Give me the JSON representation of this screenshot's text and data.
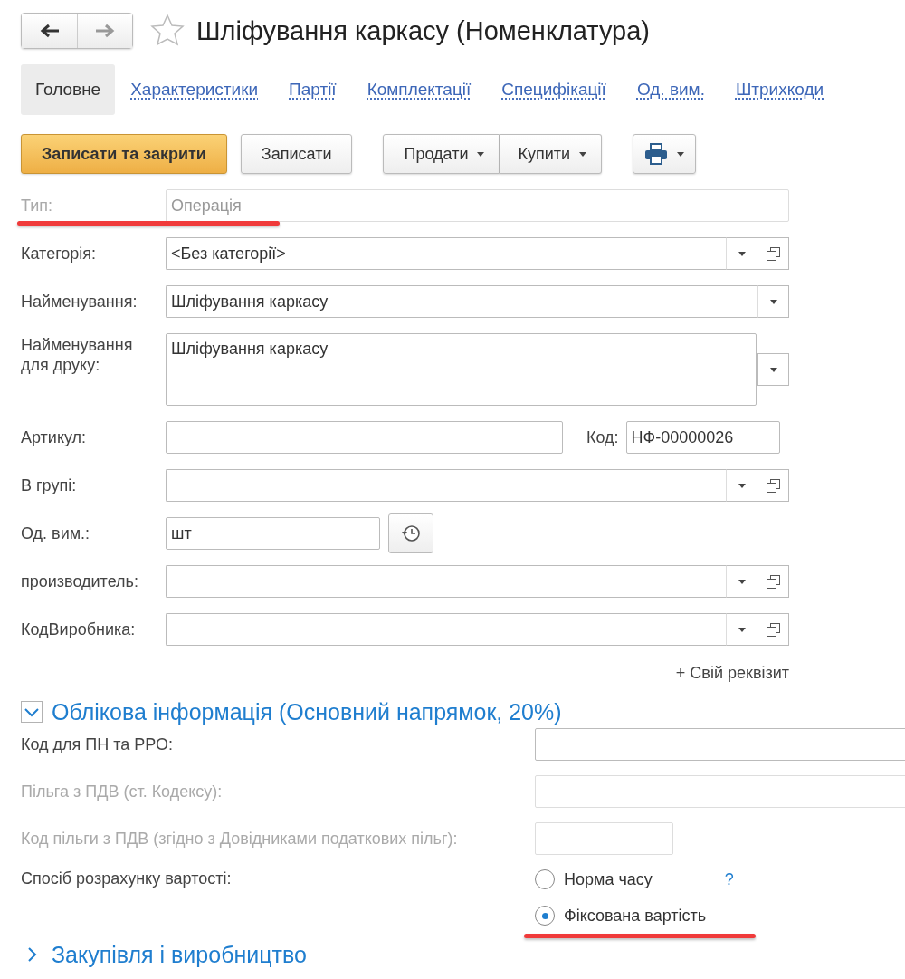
{
  "nav": [
    {
      "kind": "back",
      "disabled": false
    },
    {
      "kind": "forward",
      "disabled": true
    }
  ],
  "favorite": {
    "on": false
  },
  "title": "Шліфування каркасу (Номенклатура)",
  "tabs": [
    {
      "label": "Головне",
      "selected": true
    },
    {
      "label": "Характеристики",
      "selected": false
    },
    {
      "label": "Партії",
      "selected": false
    },
    {
      "label": "Комплектації",
      "selected": false
    },
    {
      "label": "Специфікації",
      "selected": false
    },
    {
      "label": "Од. вим.",
      "selected": false
    },
    {
      "label": "Штрихкоди",
      "selected": false
    }
  ],
  "toolbar": [
    {
      "buttons": [
        {
          "kind": "primary",
          "label": "Записати та закрити"
        }
      ]
    },
    {
      "buttons": [
        {
          "kind": "plain",
          "label": "Записати"
        }
      ]
    },
    {
      "buttons": [
        {
          "kind": "menu",
          "label": "Продати"
        },
        {
          "kind": "menu",
          "label": "Купити"
        }
      ]
    },
    {
      "buttons": [
        {
          "kind": "print"
        }
      ]
    }
  ],
  "fields": [
    {
      "kind": "text",
      "label": "Тип:",
      "value": "Операція",
      "disabled": true,
      "highlighted": true
    },
    {
      "kind": "select_open",
      "label": "Категорія:",
      "value": "<Без категорії>",
      "disabled": false
    },
    {
      "kind": "select",
      "label": "Найменування:",
      "value": "Шліфування каркасу",
      "disabled": false
    },
    {
      "kind": "textarea",
      "label": "Найменування для друку:",
      "value": "Шліфування каркасу",
      "disabled": false
    },
    {
      "kind": "pair",
      "label": "Артикул:",
      "extra_label": "Код:",
      "extra_value": "НФ-00000026",
      "disabled": false
    },
    {
      "kind": "select_open",
      "label": "В групі:",
      "disabled": false
    },
    {
      "kind": "unit",
      "label": "Од. вим.:",
      "value": "шт",
      "disabled": false
    },
    {
      "kind": "select_open",
      "label": "производитель:",
      "disabled": false
    },
    {
      "kind": "select_open",
      "label": "КодВиробника:",
      "disabled": false
    }
  ],
  "add_attribute_link": "+ Свій реквізит",
  "sections": [
    {
      "title": "Облікова інформація (Основний напрямок, 20%)",
      "expanded": true,
      "fields": [
        {
          "kind": "wide",
          "label": "Код для ПН та РРО:",
          "disabled": false
        },
        {
          "kind": "wide",
          "label": "Пільга з ПДВ (ст. Кодексу):",
          "disabled": true
        },
        {
          "kind": "short",
          "label": "Код пільги з ПДВ (згідно з Довідниками податкових пільг):",
          "disabled": true
        },
        {
          "kind": "radio",
          "label": "Спосіб розрахунку вартості:",
          "disabled": false,
          "help": "?",
          "options": [
            {
              "label": "Норма часу",
              "selected": false
            },
            {
              "label": "Фіксована вартість",
              "selected": true,
              "highlighted": true
            }
          ]
        }
      ]
    },
    {
      "title": "Закупівля і виробництво",
      "expanded": false
    }
  ]
}
